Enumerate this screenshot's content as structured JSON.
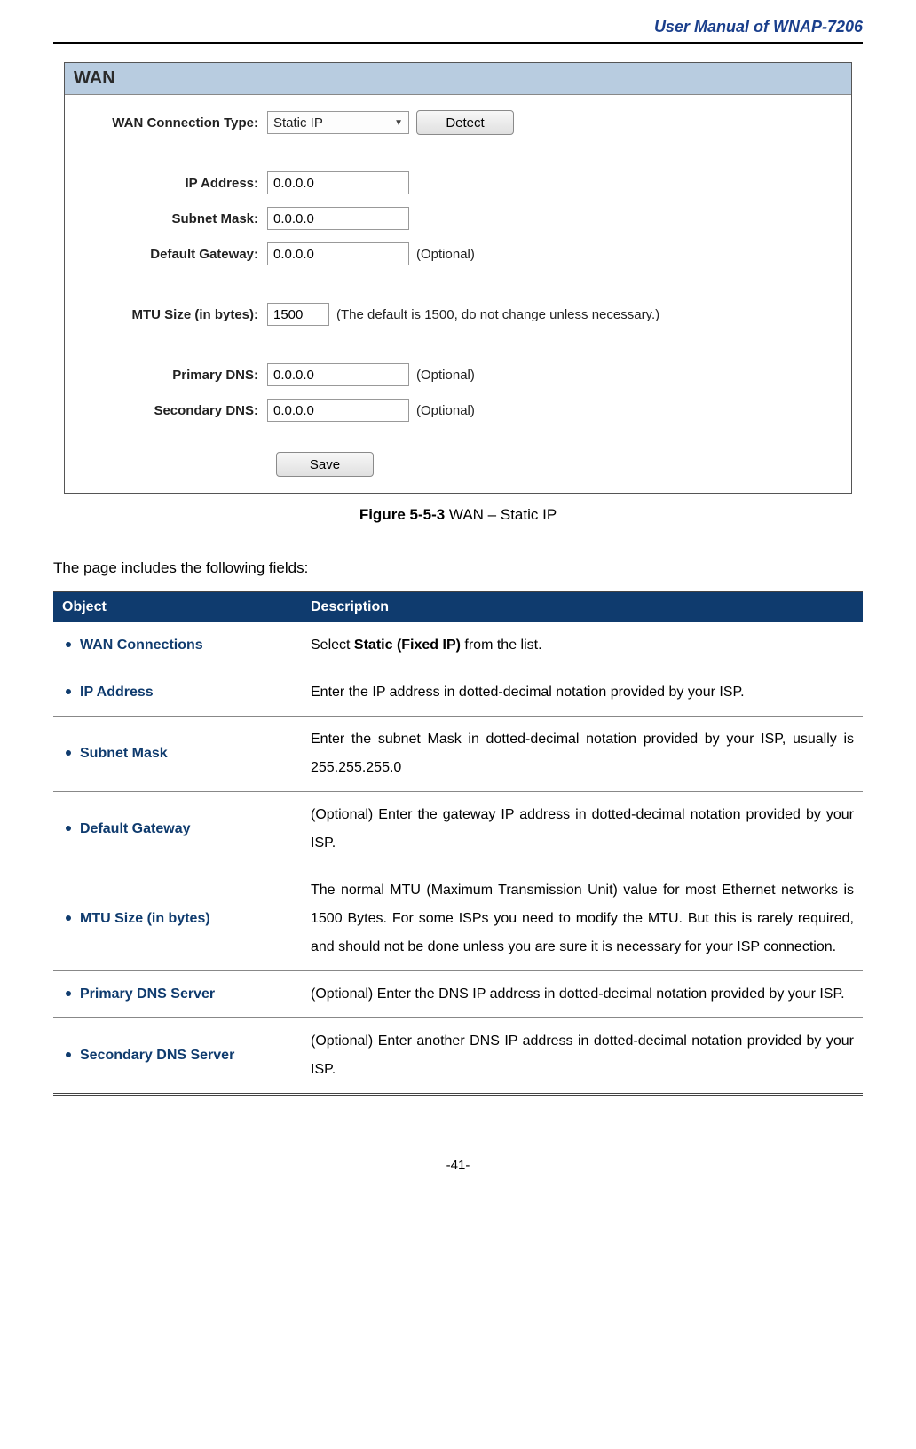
{
  "header": {
    "title": "User Manual of WNAP-7206"
  },
  "panel": {
    "title": "WAN",
    "rows": {
      "wan_type": {
        "label": "WAN Connection Type:",
        "value": "Static IP",
        "detect": "Detect"
      },
      "ip": {
        "label": "IP Address:",
        "value": "0.0.0.0"
      },
      "mask": {
        "label": "Subnet Mask:",
        "value": "0.0.0.0"
      },
      "gw": {
        "label": "Default Gateway:",
        "value": "0.0.0.0",
        "note": "(Optional)"
      },
      "mtu": {
        "label": "MTU Size (in bytes):",
        "value": "1500",
        "note": "(The default is 1500, do not change unless necessary.)"
      },
      "pdns": {
        "label": "Primary DNS:",
        "value": "0.0.0.0",
        "note": "(Optional)"
      },
      "sdns": {
        "label": "Secondary DNS:",
        "value": "0.0.0.0",
        "note": "(Optional)"
      }
    },
    "save": "Save"
  },
  "figure": {
    "prefix": "Figure 5-5-3 ",
    "rest": "WAN – Static IP"
  },
  "intro": "The page includes the following fields:",
  "table": {
    "head_obj": "Object",
    "head_desc": "Description",
    "rows": [
      {
        "obj": "WAN Connections",
        "desc_pre": "Select ",
        "desc_bold": "Static (Fixed IP)",
        "desc_post": " from the list."
      },
      {
        "obj": "IP Address",
        "desc": "Enter the IP address in dotted-decimal notation provided by your ISP."
      },
      {
        "obj": "Subnet Mask",
        "desc": "Enter the subnet Mask in dotted-decimal notation provided by your ISP, usually is 255.255.255.0"
      },
      {
        "obj": "Default Gateway",
        "desc": "(Optional) Enter the gateway IP address in dotted-decimal notation provided by your ISP."
      },
      {
        "obj": "MTU Size (in bytes)",
        "desc": "The normal MTU (Maximum Transmission Unit) value for most Ethernet networks is 1500 Bytes. For some ISPs you need to modify the MTU. But this is rarely required, and should not be done unless you are sure it is necessary for your ISP connection."
      },
      {
        "obj": "Primary DNS Server",
        "desc": "(Optional) Enter the DNS IP address in dotted-decimal notation provided by your ISP."
      },
      {
        "obj": "Secondary DNS Server",
        "desc": "(Optional) Enter another DNS IP address in dotted-decimal notation provided by your ISP."
      }
    ]
  },
  "page_num": "-41-"
}
